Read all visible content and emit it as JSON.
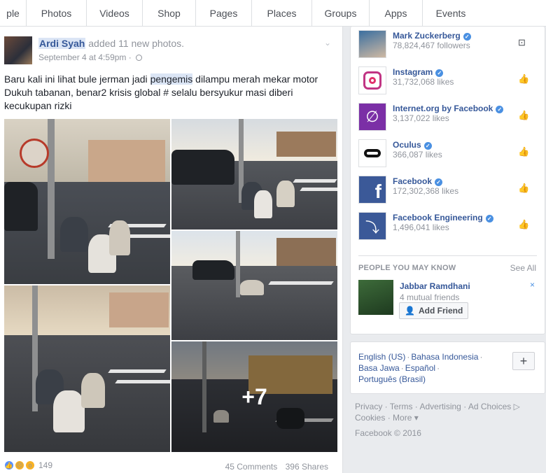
{
  "nav": {
    "tabs": [
      "ple",
      "Photos",
      "Videos",
      "Shop",
      "Pages",
      "Places",
      "Groups",
      "Apps",
      "Events"
    ]
  },
  "post": {
    "author": "Ardi Syah",
    "action": "added 11 new photos.",
    "date": "September 4 at 4:59pm",
    "separator": "·",
    "text_part1": "Baru kali ini lihat bule jerman jadi ",
    "text_highlight": "pengemis",
    "text_part2": " dilampu merah mekar motor Dukuh tabanan, benar2 krisis global # selalu bersyukur masi diberi kecukupan rizki",
    "more_photos": "+7",
    "reaction_count": "149",
    "comments": "45 Comments",
    "shares": "396 Shares"
  },
  "pages": [
    {
      "name": "Mark Zuckerberg",
      "sub": "78,824,467 followers",
      "icon": "rss-icon",
      "color": "#3b5998"
    },
    {
      "name": "Instagram",
      "sub": "31,732,068 likes",
      "icon": "thumbs-up-icon",
      "color": "#c13584"
    },
    {
      "name": "Internet.org by Facebook",
      "sub": "3,137,022 likes",
      "icon": "thumbs-up-icon",
      "color": "#7b2fa6"
    },
    {
      "name": "Oculus",
      "sub": "366,087 likes",
      "icon": "thumbs-up-icon",
      "color": "#000000"
    },
    {
      "name": "Facebook",
      "sub": "172,302,368 likes",
      "icon": "thumbs-up-icon",
      "color": "#3b5998"
    },
    {
      "name": "Facebook Engineering",
      "sub": "1,496,041 likes",
      "icon": "thumbs-up-icon",
      "color": "#3b5998"
    }
  ],
  "people": {
    "heading": "PEOPLE YOU MAY KNOW",
    "see_all": "See All",
    "name": "Jabbar Ramdhani",
    "mutual": "4 mutual friends",
    "add_label": "Add Friend",
    "close": "×"
  },
  "languages": {
    "line1": [
      "English (US)",
      "Bahasa Indonesia"
    ],
    "line2": [
      "Basa Jawa",
      "Español"
    ],
    "line3": [
      "Português (Brasil)"
    ],
    "plus": "+"
  },
  "footer": {
    "links1": [
      "Privacy",
      "Terms",
      "Advertising",
      "Ad Choices"
    ],
    "links2": [
      "Cookies",
      "More"
    ],
    "copyright": "Facebook © 2016"
  }
}
